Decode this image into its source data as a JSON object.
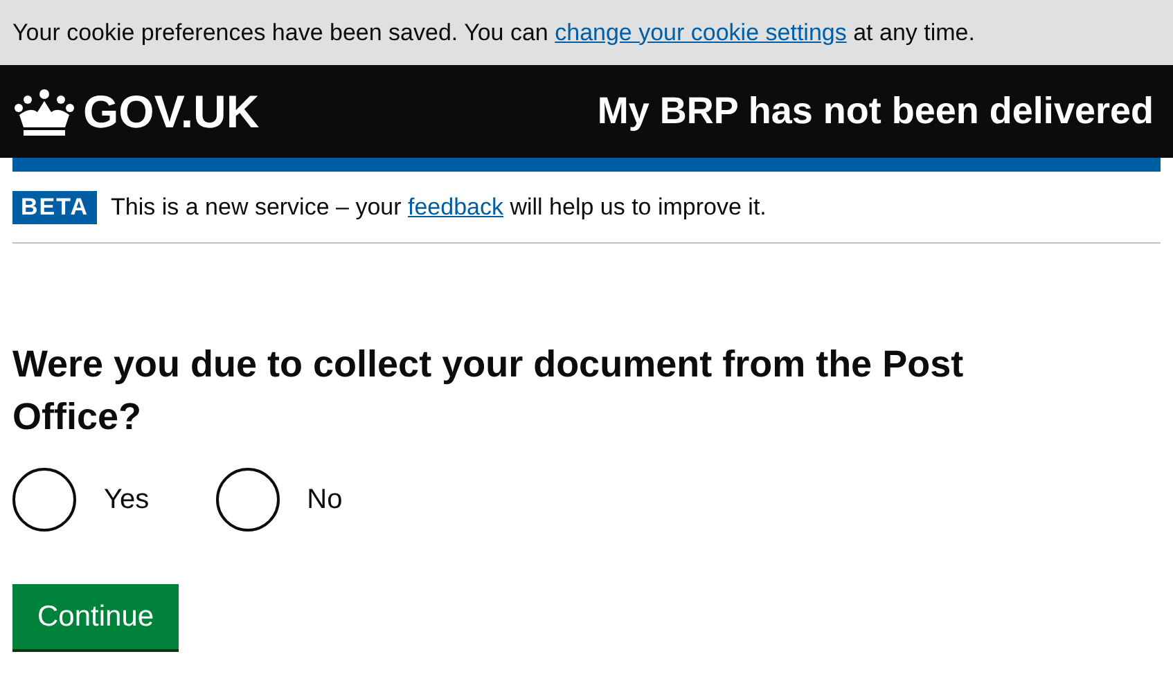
{
  "cookie_banner": {
    "before": "Your cookie preferences have been saved. You can ",
    "link": "change your cookie settings",
    "after": " at any time."
  },
  "header": {
    "logo": "GOV.UK",
    "service": "My BRP has not been delivered"
  },
  "phase_banner": {
    "tag": "BETA",
    "before": "This is a new service – your ",
    "link": "feedback",
    "after": " will help us to improve it."
  },
  "question": "Were you due to collect your document from the Post Office?",
  "options": [
    {
      "label": "Yes",
      "selected": false
    },
    {
      "label": "No",
      "selected": false
    }
  ],
  "button": "Continue"
}
